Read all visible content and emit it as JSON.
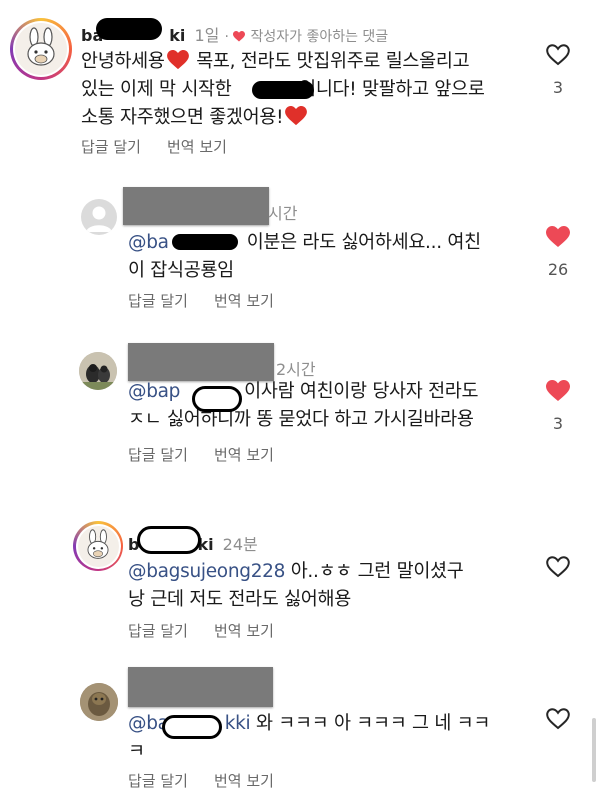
{
  "actions": {
    "reply": "답글 달기",
    "translate": "번역 보기"
  },
  "comments": [
    {
      "username_prefix": "ba",
      "username_suffix": "ki",
      "time": "1일",
      "author_liked": "작성자가 좋아하는 댓글",
      "line1": "안녕하세용",
      "line1b": " 목포, 전라도 맛집위주로 릴스올리고",
      "line2": "있는 이제 막 시작한 ",
      "line2b": "입니다! 맞팔하고 앞으로",
      "line3": "소통 자주했으면 좋겠어용!",
      "like_count": "3",
      "liked": false
    },
    {
      "time_suffix": "시간",
      "mention": "@ba",
      "text1": "이분은 라도 싫어하세요... 여친",
      "text2": "이 잡식공룡임",
      "like_count": "26",
      "liked": true
    },
    {
      "time_suffix": "2시간",
      "mention": "@bap",
      "text1": "이사람 여친이랑 당사자 전라도",
      "text2": "ㅈㄴ 싫어하니까 똥 묻었다 하고 가시길바라용",
      "like_count": "3",
      "liked": true
    },
    {
      "username_prefix": "b",
      "username_suffix": "ki",
      "time": "24분",
      "mention": "@bagsujeong228",
      "text1": " 아..ㅎㅎ 그런 말이셨구",
      "text2": "낭 근데 저도 전라도 싫어해용",
      "liked": false
    },
    {
      "mention": "@ba",
      "mention_suffix": "kki",
      "text1": " 와 ㅋㅋㅋ 아 ㅋㅋㅋ 그 네 ㅋㅋ",
      "text2": "ㅋ",
      "liked": false
    }
  ],
  "colors": {
    "heart_red": "#ed4956",
    "mention": "#385185",
    "muted": "#8e8e8e"
  }
}
